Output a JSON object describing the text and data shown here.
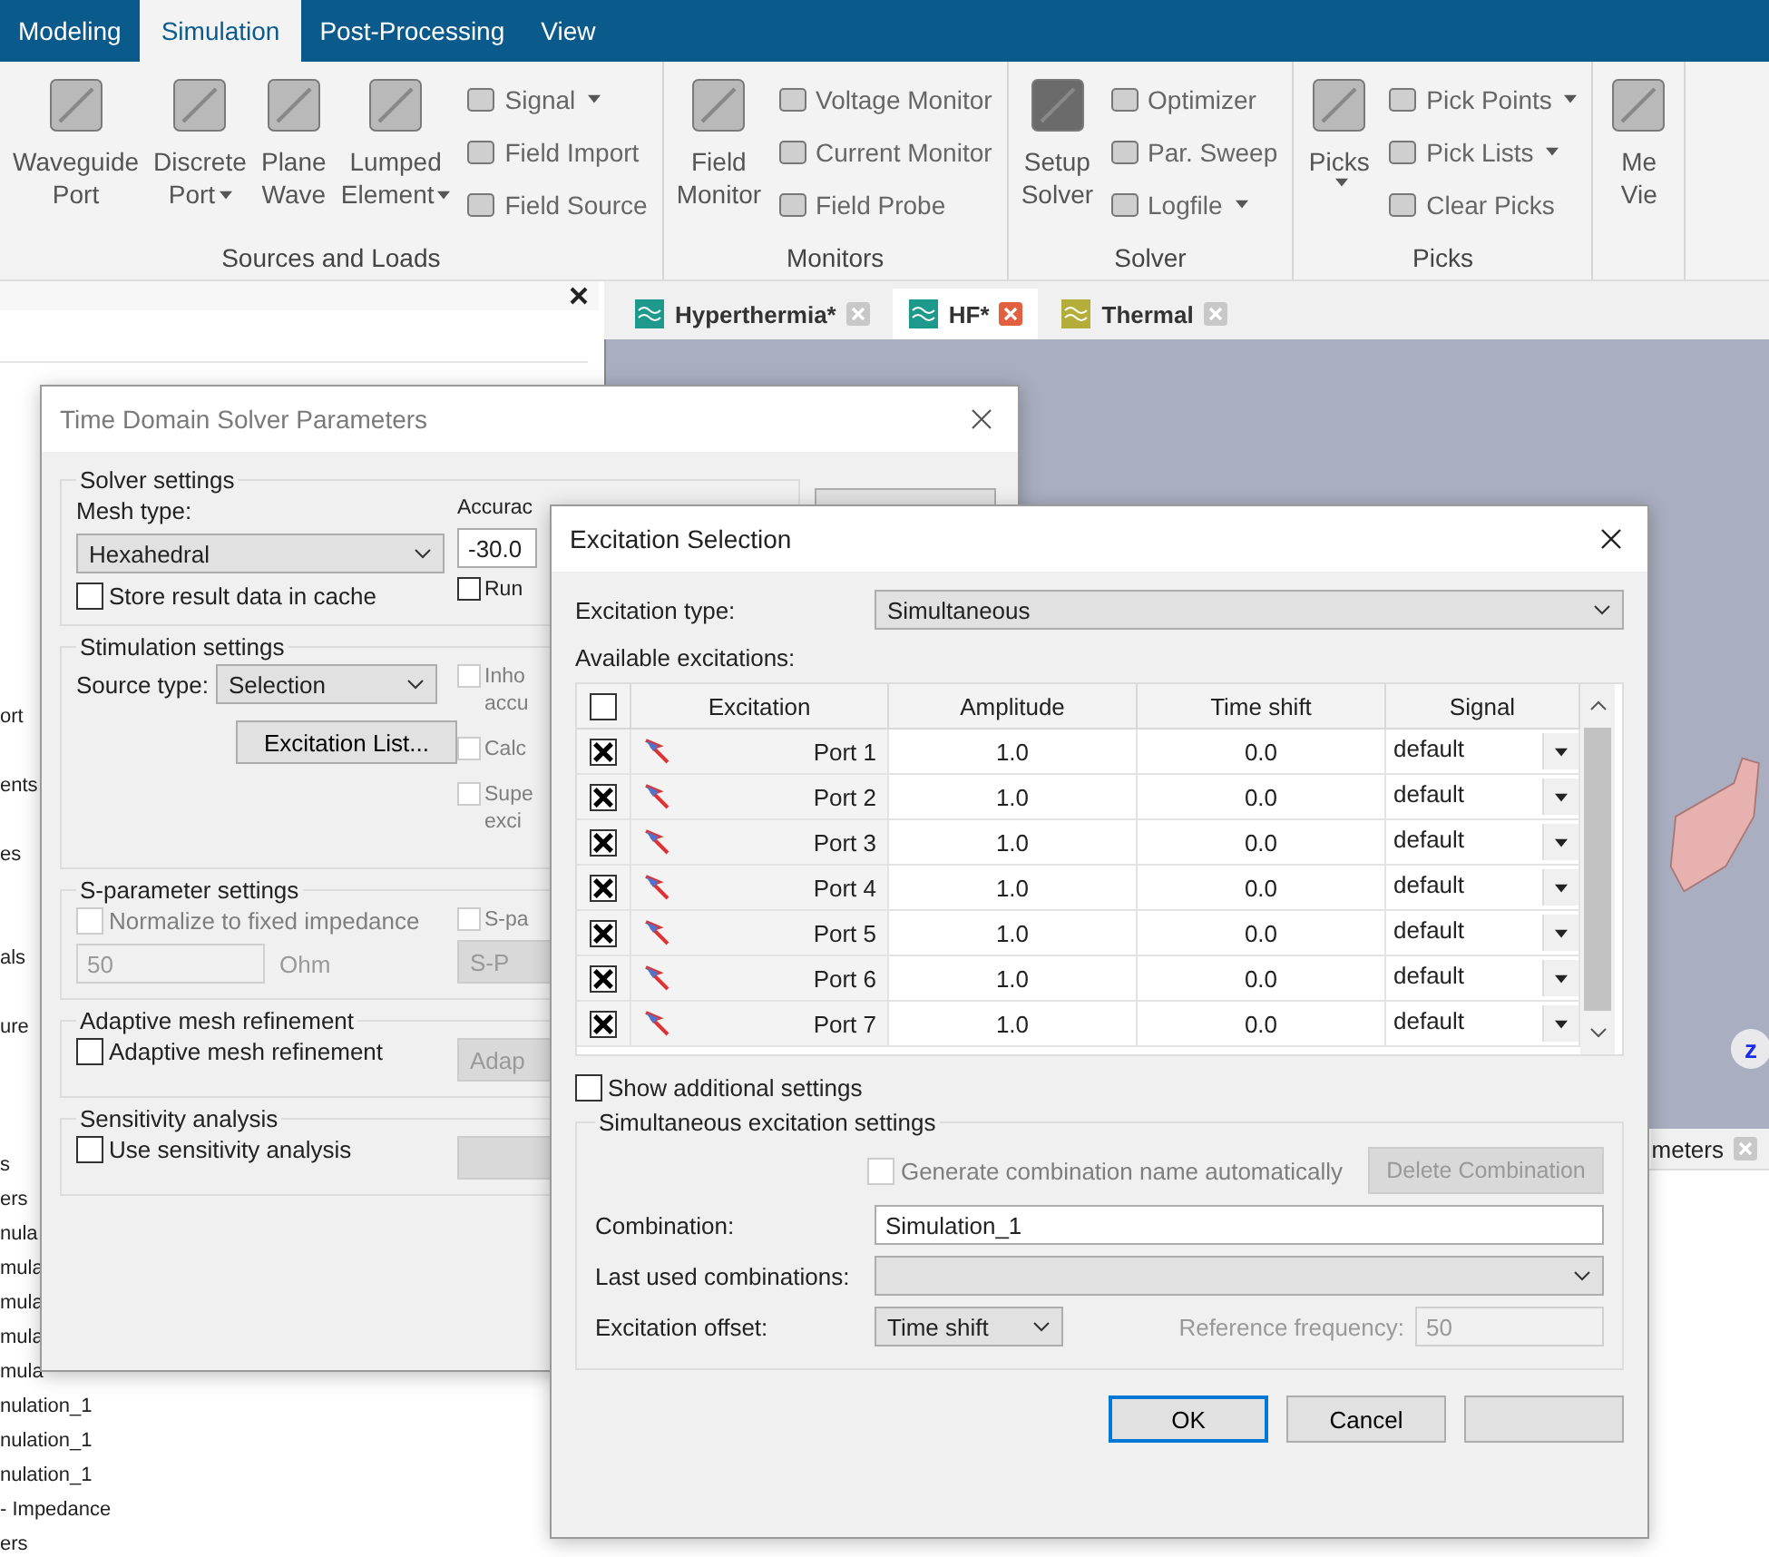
{
  "ribbon": {
    "tabs": [
      {
        "label": "Modeling",
        "selected": false
      },
      {
        "label": "Simulation",
        "selected": true
      },
      {
        "label": "Post-Processing",
        "selected": false
      },
      {
        "label": "View",
        "selected": false
      }
    ],
    "groups": [
      {
        "label": "Sources and Loads",
        "large": [
          {
            "lines": [
              "Waveguide",
              "Port"
            ],
            "dropdown": false
          },
          {
            "lines": [
              "Discrete",
              "Port"
            ],
            "dropdown": true
          },
          {
            "lines": [
              "Plane",
              "Wave"
            ],
            "dropdown": false
          },
          {
            "lines": [
              "Lumped",
              "Element"
            ],
            "dropdown": true
          }
        ],
        "small": [
          {
            "label": "Signal",
            "dropdown": true
          },
          {
            "label": "Field Import",
            "dropdown": false
          },
          {
            "label": "Field Source",
            "dropdown": false
          }
        ]
      },
      {
        "label": "Monitors",
        "large": [
          {
            "lines": [
              "Field",
              "Monitor"
            ],
            "dropdown": false
          }
        ],
        "small": [
          {
            "label": "Voltage Monitor",
            "dropdown": false
          },
          {
            "label": "Current Monitor",
            "dropdown": false
          },
          {
            "label": "Field Probe",
            "dropdown": false
          }
        ]
      },
      {
        "label": "Solver",
        "large": [
          {
            "lines": [
              "Setup",
              "Solver"
            ],
            "dropdown": false
          }
        ],
        "small": [
          {
            "label": "Optimizer",
            "dropdown": false
          },
          {
            "label": "Par. Sweep",
            "dropdown": false
          },
          {
            "label": "Logfile",
            "dropdown": true
          }
        ]
      },
      {
        "label": "Picks",
        "large": [
          {
            "lines": [
              "Picks"
            ],
            "dropdown": true
          }
        ],
        "small": [
          {
            "label": "Pick Points",
            "dropdown": true
          },
          {
            "label": "Pick Lists",
            "dropdown": true
          },
          {
            "label": "Clear Picks",
            "dropdown": false
          }
        ]
      },
      {
        "large": [
          {
            "lines": [
              "Me",
              "Vie"
            ],
            "dropdown": false
          }
        ]
      }
    ]
  },
  "tree": {
    "items": [
      "ort",
      "ents",
      "es",
      "als",
      "ure",
      "s",
      "ers",
      "nula",
      "mula",
      "mula",
      "mula",
      "mula",
      "nulation_1",
      "nulation_1",
      "nulation_1",
      "- Impedance",
      "ers"
    ]
  },
  "document_tabs": [
    {
      "label": "Hyperthermia*",
      "selected": false
    },
    {
      "label": "HF*",
      "selected": true
    },
    {
      "label": "Thermal",
      "selected": false
    }
  ],
  "viewport": {
    "axis_label": "z",
    "panel_tab": "meters"
  },
  "solver_dialog": {
    "title": "Time Domain Solver Parameters",
    "solver_settings": {
      "title": "Solver settings",
      "mesh_type_label": "Mesh type:",
      "mesh_type": "Hexahedral",
      "store_cache": {
        "label": "Store result data in cache",
        "checked": false
      },
      "accuracy_label": "Accurac",
      "accuracy": "-30.0",
      "run": {
        "label": "Run",
        "checked": false
      }
    },
    "stimulation": {
      "title": "Stimulation settings",
      "source_type_label": "Source type:",
      "source_type": "Selection",
      "excitation_list_button": "Excitation List...",
      "options": [
        {
          "lines": [
            "Inho",
            "accu"
          ],
          "checked": false,
          "disabled": true
        },
        {
          "lines": [
            "Calc"
          ],
          "checked": false,
          "disabled": true
        },
        {
          "lines": [
            "Supe",
            "exci"
          ],
          "checked": false,
          "disabled": true
        }
      ]
    },
    "s_parameter": {
      "title": "S-parameter settings",
      "normalize": {
        "label": "Normalize to fixed impedance",
        "checked": false,
        "disabled": true
      },
      "impedance": "50",
      "unit": "Ohm",
      "option": {
        "label": "S-pa",
        "checked": false,
        "disabled": true
      },
      "button": "S-P"
    },
    "adaptive": {
      "title": "Adaptive mesh refinement",
      "checkbox": {
        "label": "Adaptive mesh refinement",
        "checked": false
      },
      "button": "Adap"
    },
    "sensitivity": {
      "title": "Sensitivity analysis",
      "checkbox": {
        "label": "Use sensitivity analysis",
        "checked": false
      }
    }
  },
  "excitation_dialog": {
    "title": "Excitation Selection",
    "type_label": "Excitation type:",
    "type": "Simultaneous",
    "available_label": "Available excitations:",
    "table": {
      "all_checked": false,
      "columns": [
        "Excitation",
        "Amplitude",
        "Time shift",
        "Signal"
      ],
      "rows": [
        {
          "checked": true,
          "name": "Port 1",
          "amplitude": "1.0",
          "time_shift": "0.0",
          "signal": "default"
        },
        {
          "checked": true,
          "name": "Port 2",
          "amplitude": "1.0",
          "time_shift": "0.0",
          "signal": "default"
        },
        {
          "checked": true,
          "name": "Port 3",
          "amplitude": "1.0",
          "time_shift": "0.0",
          "signal": "default"
        },
        {
          "checked": true,
          "name": "Port 4",
          "amplitude": "1.0",
          "time_shift": "0.0",
          "signal": "default"
        },
        {
          "checked": true,
          "name": "Port 5",
          "amplitude": "1.0",
          "time_shift": "0.0",
          "signal": "default"
        },
        {
          "checked": true,
          "name": "Port 6",
          "amplitude": "1.0",
          "time_shift": "0.0",
          "signal": "default"
        },
        {
          "checked": true,
          "name": "Port 7",
          "amplitude": "1.0",
          "time_shift": "0.0",
          "signal": "default"
        }
      ]
    },
    "show_additional": {
      "label": "Show additional settings",
      "checked": false
    },
    "settings": {
      "title": "Simultaneous excitation settings",
      "generate": {
        "label": "Generate combination name automatically",
        "checked": false,
        "disabled": true
      },
      "delete_button": {
        "label": "Delete Combination",
        "disabled": true
      },
      "combination_label": "Combination:",
      "combination": "Simulation_1",
      "last_used_label": "Last used combinations:",
      "offset_label": "Excitation offset:",
      "offset": "Time shift",
      "reference_label": "Reference frequency:",
      "reference": "50",
      "reference_disabled": true
    },
    "buttons": [
      {
        "label": "OK",
        "default": true
      },
      {
        "label": "Cancel",
        "default": false
      }
    ]
  }
}
